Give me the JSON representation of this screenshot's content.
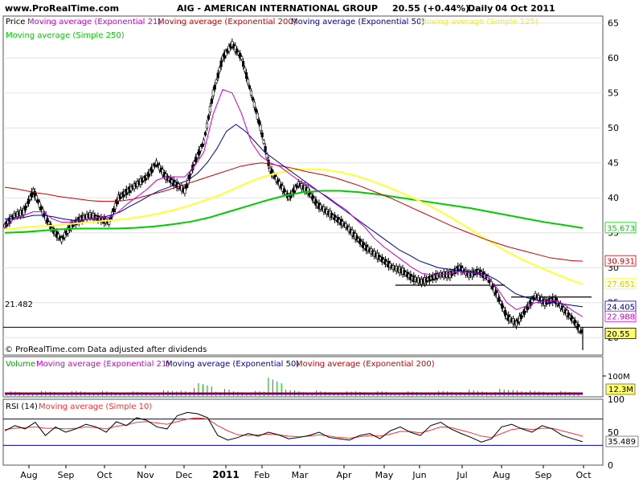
{
  "header": {
    "site": "www.ProRealTime.com",
    "symbol": "AIG - AMERICAN INTERNATIONAL GROUP",
    "quote": "20.55 (+0.44%)",
    "period": "Daily",
    "date": "04 Oct 2011"
  },
  "colors": {
    "background": "#ffffff",
    "panel_bg": "#ffffff",
    "ema21": "#cc00cc",
    "ema200": "#cc0000",
    "ema50": "#000099",
    "sma125": "#ffff33",
    "sma250": "#00cc00",
    "volume": "#00aa00",
    "rsi": "#000000",
    "rsi_ma": "#ff3333"
  },
  "price_panel": {
    "legend_price": "Price",
    "legend_ema21": "Moving average (Exponential 21)",
    "legend_ema200": "Moving average (Exponential 200)",
    "legend_ema50": "Moving average (Exponential 50)",
    "legend_sma125": "Moving average (Simple 125)",
    "legend_sma250": "Moving average (Simple 250)",
    "footer_note": "© ProRealTime.com  Data adjusted after dividends",
    "hline_value": 21.482,
    "hline_label": "21.482",
    "badges": {
      "sma250": "35.673",
      "ema200": "30.931",
      "sma125": "27.651",
      "ema50": "24.405",
      "ema21": "22.988",
      "price": "20.55"
    }
  },
  "volume_panel": {
    "legend_volume": "Volume",
    "legend_ema21": "Moving average (Exponential 21)",
    "legend_ema50": "Moving average (Exponential 50)",
    "legend_ema200": "Moving average (Exponential 200)",
    "tick_100m": "100M",
    "badge": "12.3M"
  },
  "rsi_panel": {
    "legend_rsi": "RSI (14)",
    "legend_ma": "Moving average (Simple 10)",
    "badge": "35.489"
  },
  "x_labels": {
    "aug": "Aug",
    "sep": "Sep",
    "oct": "Oct",
    "nov": "Nov",
    "dec": "Dec",
    "y2011": "2011",
    "feb": "Feb",
    "mar": "Mar",
    "apr": "Apr",
    "may": "May",
    "jun": "Jun",
    "jul": "Jul",
    "aug2": "Aug",
    "sep2": "Sep",
    "oct2": "Oct"
  },
  "chart_data": [
    {
      "type": "line",
      "title": "AIG - AMERICAN INTERNATIONAL GROUP",
      "period": "Daily",
      "yticks": [
        20,
        25,
        30,
        35,
        40,
        45,
        50,
        55,
        60,
        65
      ],
      "ylim": [
        17.5,
        66
      ],
      "x_categories": [
        "Aug",
        "Sep",
        "Oct",
        "Nov",
        "Dec",
        "2011",
        "Feb",
        "Mar",
        "Apr",
        "May",
        "Jun",
        "Jul",
        "Aug",
        "Sep",
        "Oct"
      ],
      "series": [
        {
          "name": "Price",
          "values": [
            36,
            37.5,
            38,
            41,
            38,
            35.5,
            34,
            36,
            37,
            37.5,
            37,
            36.5,
            40,
            41,
            42,
            43,
            45,
            43,
            42,
            41,
            45,
            48,
            55,
            60,
            62,
            60,
            55,
            50,
            44,
            42,
            40,
            42,
            41,
            39,
            38,
            37,
            36,
            34.5,
            33,
            32,
            31,
            30,
            29.5,
            28.5,
            28,
            28.5,
            29,
            29,
            30,
            29,
            29.5,
            28.5,
            26,
            23,
            22,
            24,
            26,
            25,
            25.5,
            24,
            22.5,
            20.55
          ]
        },
        {
          "name": "Moving average (Exponential 21)",
          "values": [
            36,
            37,
            37.5,
            38,
            38,
            37,
            36.5,
            36.5,
            36.8,
            37,
            37.2,
            37.2,
            38,
            39.2,
            40.2,
            41.2,
            42.5,
            43,
            43,
            43,
            44.5,
            46.5,
            52,
            55.5,
            55,
            52,
            48,
            46,
            45,
            44.5,
            43.5,
            42.5,
            41.8,
            41,
            40.2,
            39.2,
            38.3,
            37,
            35.8,
            34.2,
            33,
            32,
            31,
            30,
            29.2,
            29,
            29,
            29.2,
            29.5,
            29.3,
            29.2,
            28.6,
            27,
            25,
            24,
            24.5,
            25,
            25.2,
            25.3,
            24.8,
            23.8,
            22.988
          ]
        },
        {
          "name": "Moving average (Exponential 200)",
          "values": [
            41.5,
            41.3,
            41,
            40.7,
            40.5,
            40.2,
            40,
            39.8,
            39.6,
            39.5,
            39.5,
            39.6,
            39.8,
            40.2,
            40.6,
            41,
            41.5,
            42,
            42.5,
            43,
            43.5,
            44,
            44.5,
            44.8,
            45,
            44.8,
            44.5,
            44.2,
            43.8,
            43.5,
            43.2,
            42.8,
            42.3,
            41.8,
            41.2,
            40.6,
            40,
            39.3,
            38.6,
            37.9,
            37.2,
            36.5,
            35.8,
            35.2,
            34.6,
            34,
            33.5,
            33,
            32.6,
            32.2,
            31.8,
            31.4,
            31.2,
            31,
            30.931
          ]
        },
        {
          "name": "Moving average (Exponential 50)",
          "values": [
            37,
            37,
            37.2,
            37.5,
            37.5,
            37.3,
            37,
            36.8,
            36.8,
            37,
            37.2,
            37.5,
            38,
            38.8,
            39.5,
            40.3,
            41,
            41.5,
            42,
            42.5,
            43.5,
            45,
            47,
            49.5,
            50.5,
            49.5,
            48,
            46.5,
            45.5,
            44.5,
            43.5,
            42.5,
            41.5,
            40.5,
            39.5,
            38.5,
            37.5,
            36.5,
            35.5,
            34.5,
            33.5,
            32.5,
            31.8,
            31,
            30.5,
            30,
            29.8,
            29.6,
            29.5,
            29.3,
            29,
            28.3,
            27.3,
            26.3,
            25.8,
            25.4,
            25.2,
            25,
            24.8,
            24.6,
            24.405
          ]
        },
        {
          "name": "Moving average (Simple 125)",
          "values": [
            35.5,
            35.7,
            35.9,
            36,
            36.2,
            36.4,
            36.6,
            36.8,
            37,
            37.3,
            37.7,
            38.2,
            38.8,
            39.5,
            40.3,
            41.2,
            42.2,
            43,
            43.6,
            44,
            44.1,
            44,
            43.7,
            43.2,
            42.5,
            41.7,
            40.8,
            39.8,
            38.8,
            37.6,
            36.3,
            35,
            33.6,
            32.3,
            31.2,
            30.2,
            29.3,
            28.4,
            27.651
          ]
        },
        {
          "name": "Moving average (Simple 250)",
          "values": [
            35,
            35.1,
            35.3,
            35.5,
            35.6,
            35.6,
            35.6,
            35.7,
            35.9,
            36.2,
            36.6,
            37.2,
            38,
            38.8,
            39.6,
            40.3,
            40.8,
            41,
            41,
            40.8,
            40.5,
            40.1,
            39.7,
            39.3,
            38.9,
            38.5,
            38,
            37.5,
            37,
            36.5,
            36.1,
            35.673
          ]
        }
      ]
    },
    {
      "type": "bar",
      "title": "Volume",
      "yticks_label": "100M",
      "last_value": "12.3M",
      "series": [
        {
          "name": "Volume",
          "values": [
            12,
            12,
            13,
            12,
            14,
            13,
            12,
            12,
            13,
            15,
            20,
            35,
            18,
            14,
            13,
            60,
            16,
            14,
            13,
            12,
            14,
            13,
            12,
            12,
            13,
            14,
            16,
            15,
            18,
            20,
            14,
            13,
            12.3
          ]
        },
        {
          "name": "Moving average (Exponential 21)",
          "values": []
        },
        {
          "name": "Moving average (Exponential 50)",
          "values": []
        },
        {
          "name": "Moving average (Exponential 200)",
          "values": []
        }
      ]
    },
    {
      "type": "line",
      "title": "RSI (14)",
      "yticks": [
        0,
        50,
        100
      ],
      "ylim": [
        0,
        100
      ],
      "series": [
        {
          "name": "RSI (14)",
          "values": [
            52,
            60,
            55,
            65,
            45,
            58,
            50,
            55,
            62,
            58,
            50,
            66,
            60,
            72,
            68,
            58,
            55,
            75,
            80,
            78,
            72,
            45,
            38,
            42,
            48,
            44,
            50,
            46,
            40,
            42,
            45,
            50,
            42,
            40,
            38,
            45,
            48,
            40,
            52,
            58,
            50,
            45,
            60,
            65,
            55,
            48,
            42,
            35,
            40,
            58,
            62,
            55,
            50,
            60,
            55,
            45,
            40,
            35.489
          ]
        },
        {
          "name": "Moving average (Simple 10)",
          "values": [
            54,
            56,
            57,
            58,
            56,
            56,
            55,
            56,
            58,
            57,
            55,
            59,
            61,
            65,
            66,
            64,
            62,
            66,
            70,
            72,
            70,
            60,
            52,
            46,
            45,
            46,
            47,
            46,
            44,
            43,
            44,
            46,
            44,
            42,
            41,
            43,
            45,
            44,
            47,
            51,
            51,
            49,
            53,
            58,
            57,
            53,
            49,
            44,
            42,
            48,
            54,
            56,
            54,
            56,
            56,
            52,
            48,
            44
          ]
        }
      ]
    }
  ]
}
